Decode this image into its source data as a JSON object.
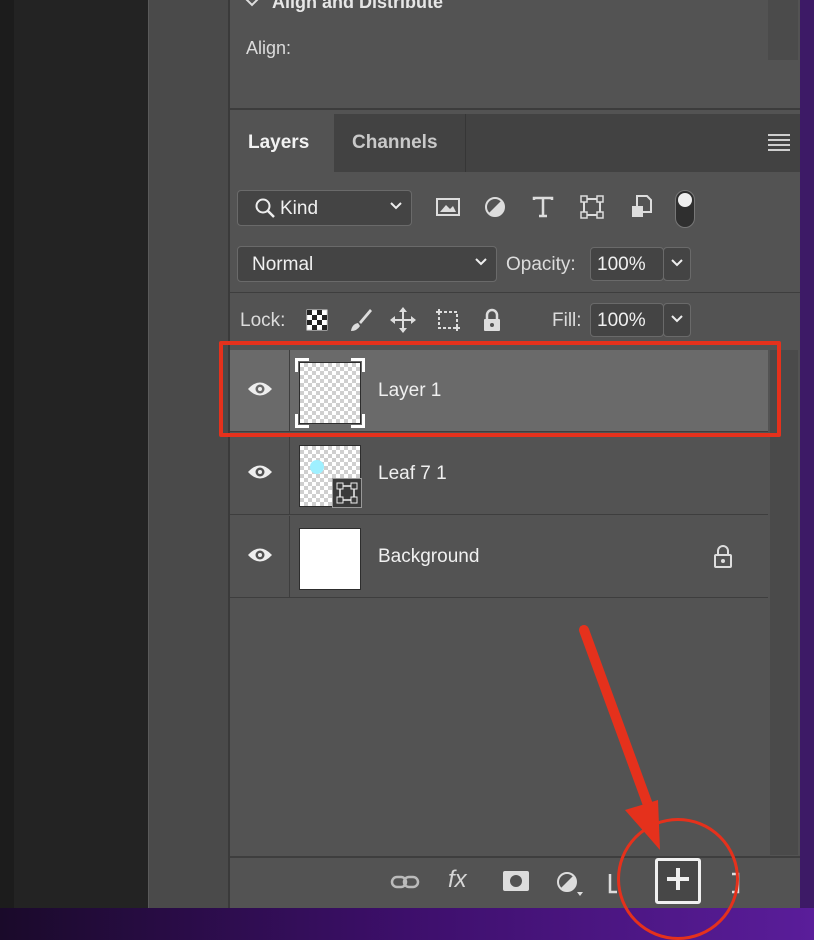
{
  "align_section": {
    "title": "Align and Distribute",
    "align_label": "Align:"
  },
  "tabs": [
    {
      "label": "Layers",
      "active": true
    },
    {
      "label": "Channels",
      "active": false
    }
  ],
  "filter": {
    "kind_label": "Kind",
    "filter_icons": [
      "image-filter-icon",
      "adjustment-filter-icon",
      "type-filter-icon",
      "shape-filter-icon",
      "smart-object-filter-icon"
    ]
  },
  "blend": {
    "mode": "Normal",
    "opacity_label": "Opacity:",
    "opacity_value": "100%"
  },
  "lock": {
    "label": "Lock:",
    "fill_label": "Fill:",
    "fill_value": "100%",
    "lock_icons": [
      "lock-transparent-pixels-icon",
      "lock-image-pixels-icon",
      "lock-position-icon",
      "lock-artboard-icon",
      "lock-all-icon"
    ]
  },
  "layers": [
    {
      "name": "Layer 1",
      "selected": true,
      "visible": true,
      "thumb": "transparent",
      "locked": false
    },
    {
      "name": "Leaf 7 1",
      "selected": false,
      "visible": true,
      "thumb": "smart-object",
      "locked": false
    },
    {
      "name": "Background",
      "selected": false,
      "visible": true,
      "thumb": "white",
      "locked": true
    }
  ],
  "bottom_bar": {
    "icons": [
      "link-layers-icon",
      "fx-icon",
      "add-mask-icon",
      "adjustment-layer-icon",
      "new-group-icon",
      "create-new-layer-icon",
      "delete-layer-icon"
    ],
    "fx_text": "fx"
  },
  "colors": {
    "annotation": "#e5311c",
    "panel_bg": "#535353",
    "selected_row": "#6a6a6a"
  }
}
